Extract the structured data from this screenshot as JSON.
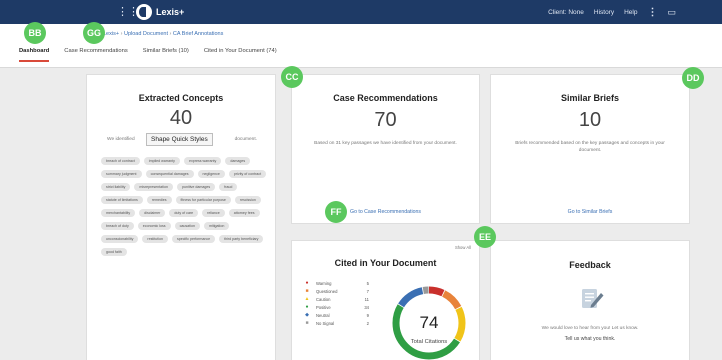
{
  "topbar": {
    "logo_text": "Lexis+",
    "client_label": "Client: None",
    "history_label": "History",
    "help_label": "Help"
  },
  "breadcrumb": {
    "items": [
      "Lexis+",
      "Upload Document",
      "CA Brief Annotations"
    ]
  },
  "tabs": [
    "Dashboard",
    "Case Recommendations",
    "Similar Briefs (10)",
    "Cited in Your Document (74)"
  ],
  "tooltip": "Shape Quick Styles",
  "concepts": {
    "title": "Extracted Concepts",
    "count": "40",
    "desc_left": "We identified",
    "desc_right": "document.",
    "chips": [
      "breach of contract",
      "implied warranty",
      "express warranty",
      "damages",
      "summary judgment",
      "consequential damages",
      "negligence",
      "privity of contract",
      "strict liability",
      "misrepresentation",
      "punitive damages",
      "fraud",
      "statute of limitations",
      "remedies",
      "fitness for particular purpose",
      "rescission",
      "merchantability",
      "disclaimer",
      "duty of care",
      "reliance",
      "attorney fees",
      "breach of duty",
      "economic loss",
      "causation",
      "mitigation",
      "unconscionability",
      "restitution",
      "specific performance",
      "third party beneficiary",
      "good faith"
    ]
  },
  "case_recs": {
    "title": "Case Recommendations",
    "count": "70",
    "desc": "Based on 31 key passages we have identified from your document.",
    "link": "Go to Case Recommendations"
  },
  "similar": {
    "title": "Similar Briefs",
    "count": "10",
    "desc": "Briefs recommended based on the key passages and concepts in your document.",
    "link": "Go to Similar Briefs"
  },
  "cited": {
    "title": "Cited in Your Document",
    "show_all": "Show All",
    "total": "74",
    "total_label": "Total Citations",
    "legend": [
      {
        "name": "Warning",
        "count": "5",
        "color": "#c9302c",
        "symbol": "●"
      },
      {
        "name": "Questioned",
        "count": "7",
        "color": "#e8833a",
        "symbol": "■"
      },
      {
        "name": "Caution",
        "count": "11",
        "color": "#f0c419",
        "symbol": "▲"
      },
      {
        "name": "Positive",
        "count": "34",
        "color": "#2f9e44",
        "symbol": "●"
      },
      {
        "name": "Neutral",
        "count": "9",
        "color": "#3a6fb3",
        "symbol": "◆"
      },
      {
        "name": "No Signal",
        "count": "2",
        "color": "#999999",
        "symbol": "■"
      }
    ]
  },
  "feedback": {
    "title": "Feedback",
    "desc": "We would love to hear from you! Let us know.",
    "link": "Tell us what you think."
  },
  "markers": [
    "BB",
    "GG",
    "CC",
    "DD",
    "FF",
    "EE"
  ]
}
